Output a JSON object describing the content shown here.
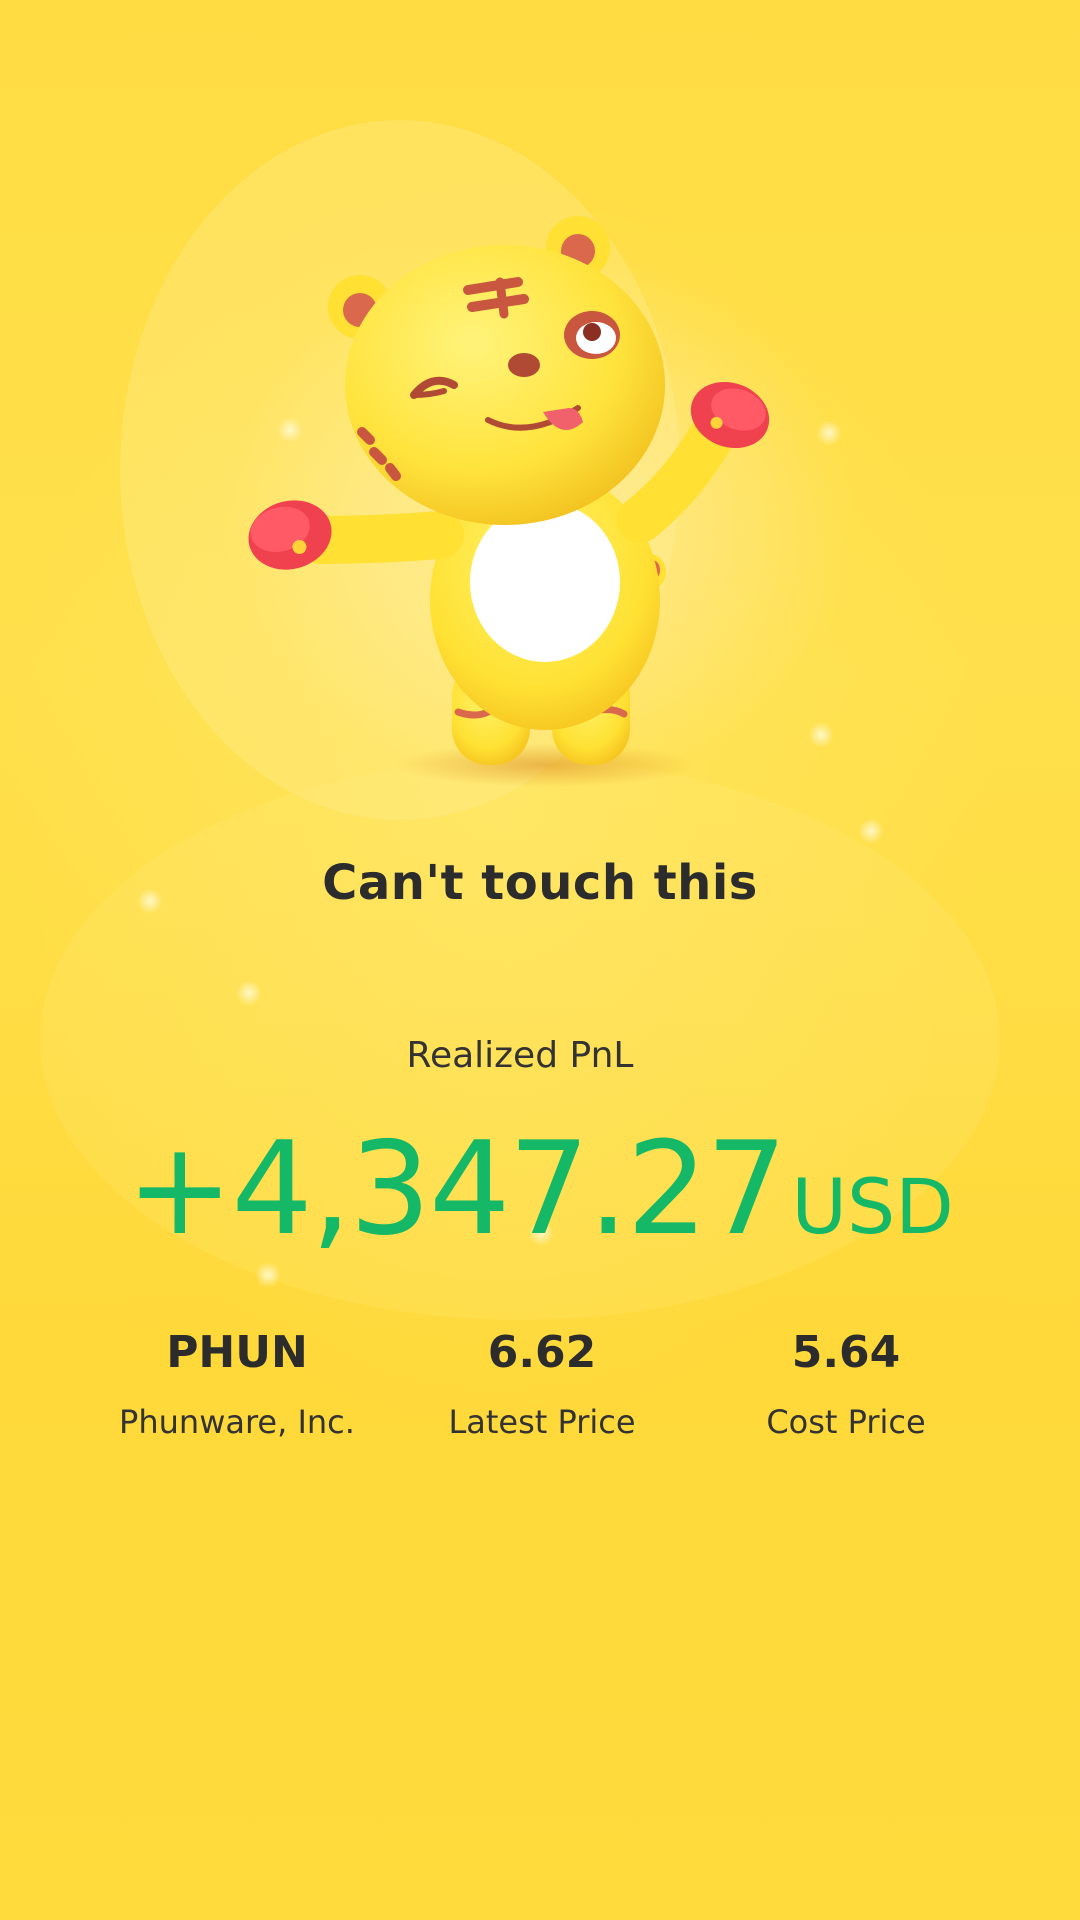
{
  "headline": "Can't touch this",
  "pnl": {
    "label": "Realized PnL",
    "amount": "+4,347.27",
    "currency": "USD"
  },
  "stats": [
    {
      "value": "PHUN",
      "label": "Phunware, Inc."
    },
    {
      "value": "6.62",
      "label": "Latest Price"
    },
    {
      "value": "5.64",
      "label": "Cost Price"
    }
  ],
  "colors": {
    "background": "#ffd93a",
    "gain": "#14b866",
    "text": "#2c2c2c"
  },
  "icons": {
    "mascot": "tiger-mascot-icon"
  }
}
